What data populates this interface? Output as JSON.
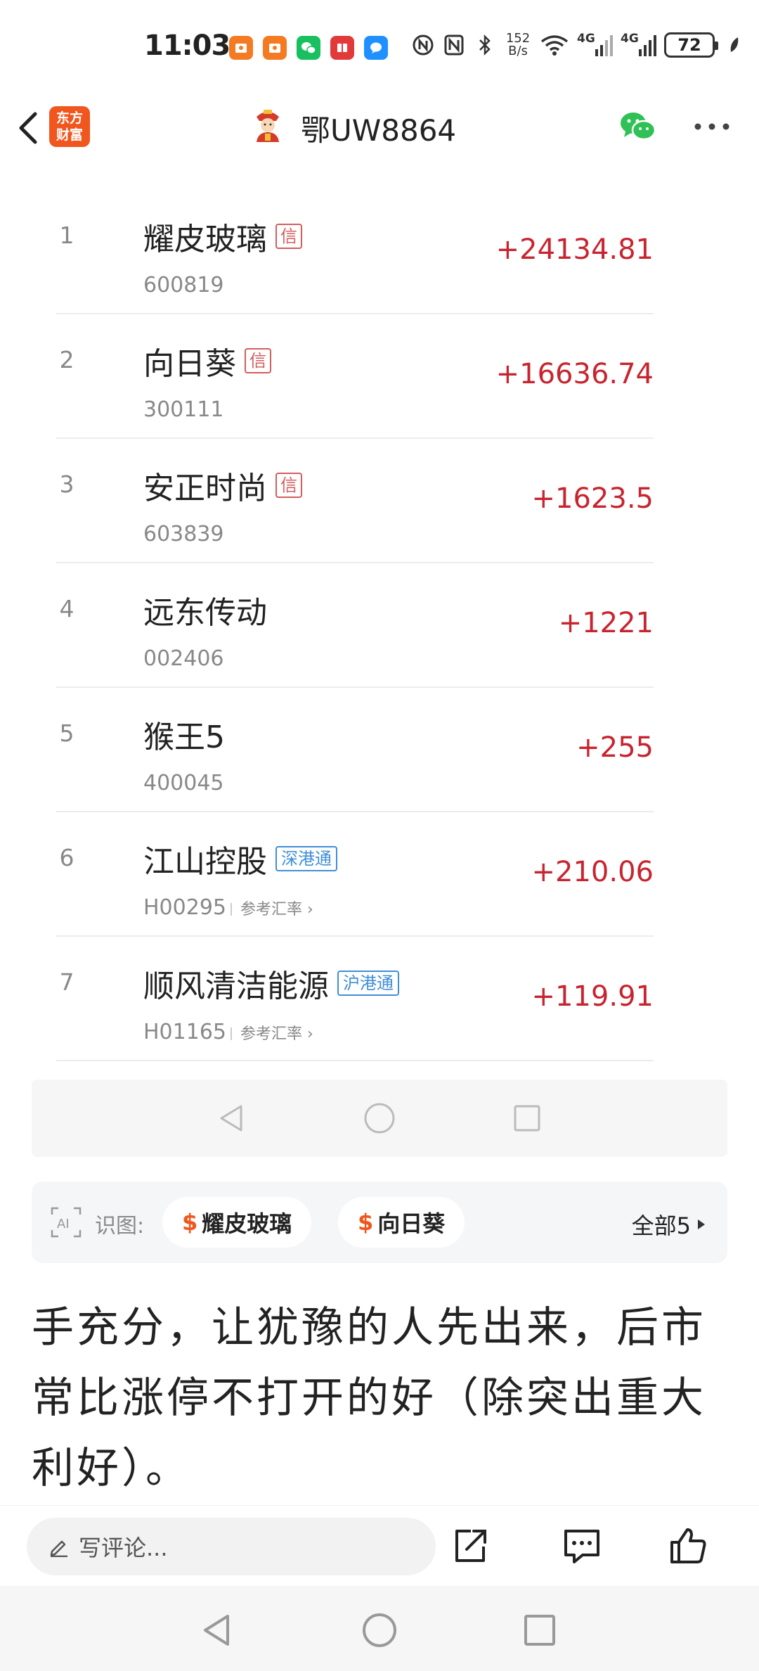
{
  "status_bar": {
    "time": "11:03",
    "speed_top": "152",
    "speed_unit": "B/s",
    "net1": "4G",
    "net2": "4G",
    "battery": "72"
  },
  "header": {
    "title": "鄂UW8864",
    "logo_line1": "东方",
    "logo_line2": "财富"
  },
  "stocks": [
    {
      "rank": "1",
      "name": "耀皮玻璃",
      "tag": "信",
      "tag_type": "xin",
      "code": "600819",
      "ref": "",
      "value": "+24134.81"
    },
    {
      "rank": "2",
      "name": "向日葵",
      "tag": "信",
      "tag_type": "xin",
      "code": "300111",
      "ref": "",
      "value": "+16636.74"
    },
    {
      "rank": "3",
      "name": "安正时尚",
      "tag": "信",
      "tag_type": "xin",
      "code": "603839",
      "ref": "",
      "value": "+1623.5"
    },
    {
      "rank": "4",
      "name": "远东传动",
      "tag": "",
      "tag_type": "",
      "code": "002406",
      "ref": "",
      "value": "+1221"
    },
    {
      "rank": "5",
      "name": "猴王5",
      "tag": "",
      "tag_type": "",
      "code": "400045",
      "ref": "",
      "value": "+255"
    },
    {
      "rank": "6",
      "name": "江山控股",
      "tag": "深港通",
      "tag_type": "blue",
      "code": "H00295",
      "ref": "参考汇率 ›",
      "value": "+210.06"
    },
    {
      "rank": "7",
      "name": "顺风清洁能源",
      "tag": "沪港通",
      "tag_type": "blue",
      "code": "H01165",
      "ref": "参考汇率 ›",
      "value": "+119.91"
    }
  ],
  "id_bar": {
    "label": "识图:",
    "chip1": "耀皮玻璃",
    "chip2": "向日葵",
    "dollar": "$",
    "all": "全部5"
  },
  "article": {
    "text": "手充分，让犹豫的人先出来，后市常比涨停不打开的好（除突出重大利好）。"
  },
  "comment_bar": {
    "placeholder": "写评论..."
  },
  "colors": {
    "up_red": "#c8242f",
    "brand_orange": "#f0561d",
    "tag_blue": "#3f8fd8"
  }
}
